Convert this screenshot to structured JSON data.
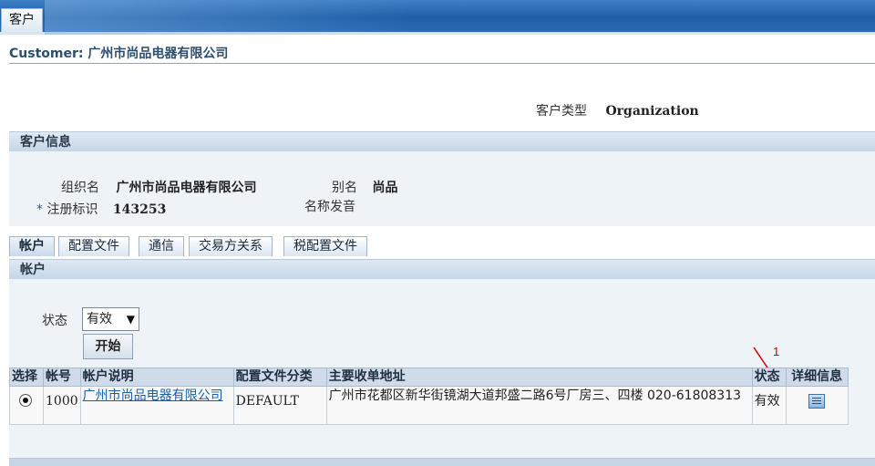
{
  "top_tab": "客户",
  "page_title": "Customer: 广州市尚品电器有限公司",
  "customer_type": {
    "label": "客户类型",
    "value": "Organization"
  },
  "info_section": {
    "title": "客户信息",
    "org_name_label": "组织名",
    "org_name": "广州市尚品电器有限公司",
    "alias_label": "别名",
    "alias": "尚品",
    "reg_required": "*",
    "reg_label": "注册标识",
    "reg_value": "143253",
    "pronunciation_label": "名称发音"
  },
  "tabs": [
    "帐户",
    "配置文件",
    "通信",
    "交易方关系",
    "税配置文件"
  ],
  "accounts_section": {
    "title": "帐户",
    "status_label": "状态",
    "status_value": "有效",
    "go_button": "开始"
  },
  "table": {
    "headers": [
      "选择",
      "帐号",
      "帐户说明",
      "配置文件分类",
      "主要收单地址",
      "状态",
      "详细信息"
    ],
    "rows": [
      {
        "selected": true,
        "account_no": "1000",
        "description": "广州市尚品电器有限公司",
        "profile_class": "DEFAULT",
        "address": "广州市花都区新华街镜湖大道邦盛二路6号厂房三、四楼 020-61808313",
        "status": "有效",
        "detail_icon": "details-icon"
      }
    ]
  },
  "annotation": {
    "number": "1",
    "color": "#d00000"
  },
  "colors": {
    "banner": "#1f5fa8",
    "section_bar": "#c6d6e6",
    "link": "#1a5ea8",
    "title": "#2e4e6e"
  }
}
